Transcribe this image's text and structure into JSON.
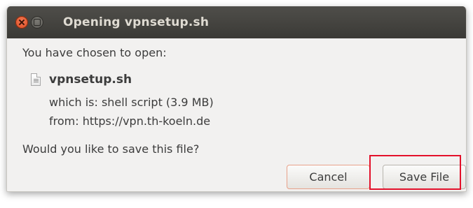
{
  "dialog": {
    "title": "Opening vpnsetup.sh",
    "intro": "You have chosen to open:",
    "file_name": "vpnsetup.sh",
    "type_line": "which is:  shell script (3.9 MB)",
    "source_line": "from:  https://vpn.th-koeln.de",
    "question": "Would you like to save this file?",
    "cancel_label": "Cancel",
    "save_label": "Save File"
  },
  "icons": {
    "close": "close-icon",
    "minimize": "minimize-icon",
    "file": "shell-script-file-icon"
  },
  "colors": {
    "titlebar": "#3b3a36",
    "close_button": "#e95420",
    "dialog_background": "#f2f1f0",
    "highlight": "#e3102a",
    "text": "#3c3c3c"
  }
}
